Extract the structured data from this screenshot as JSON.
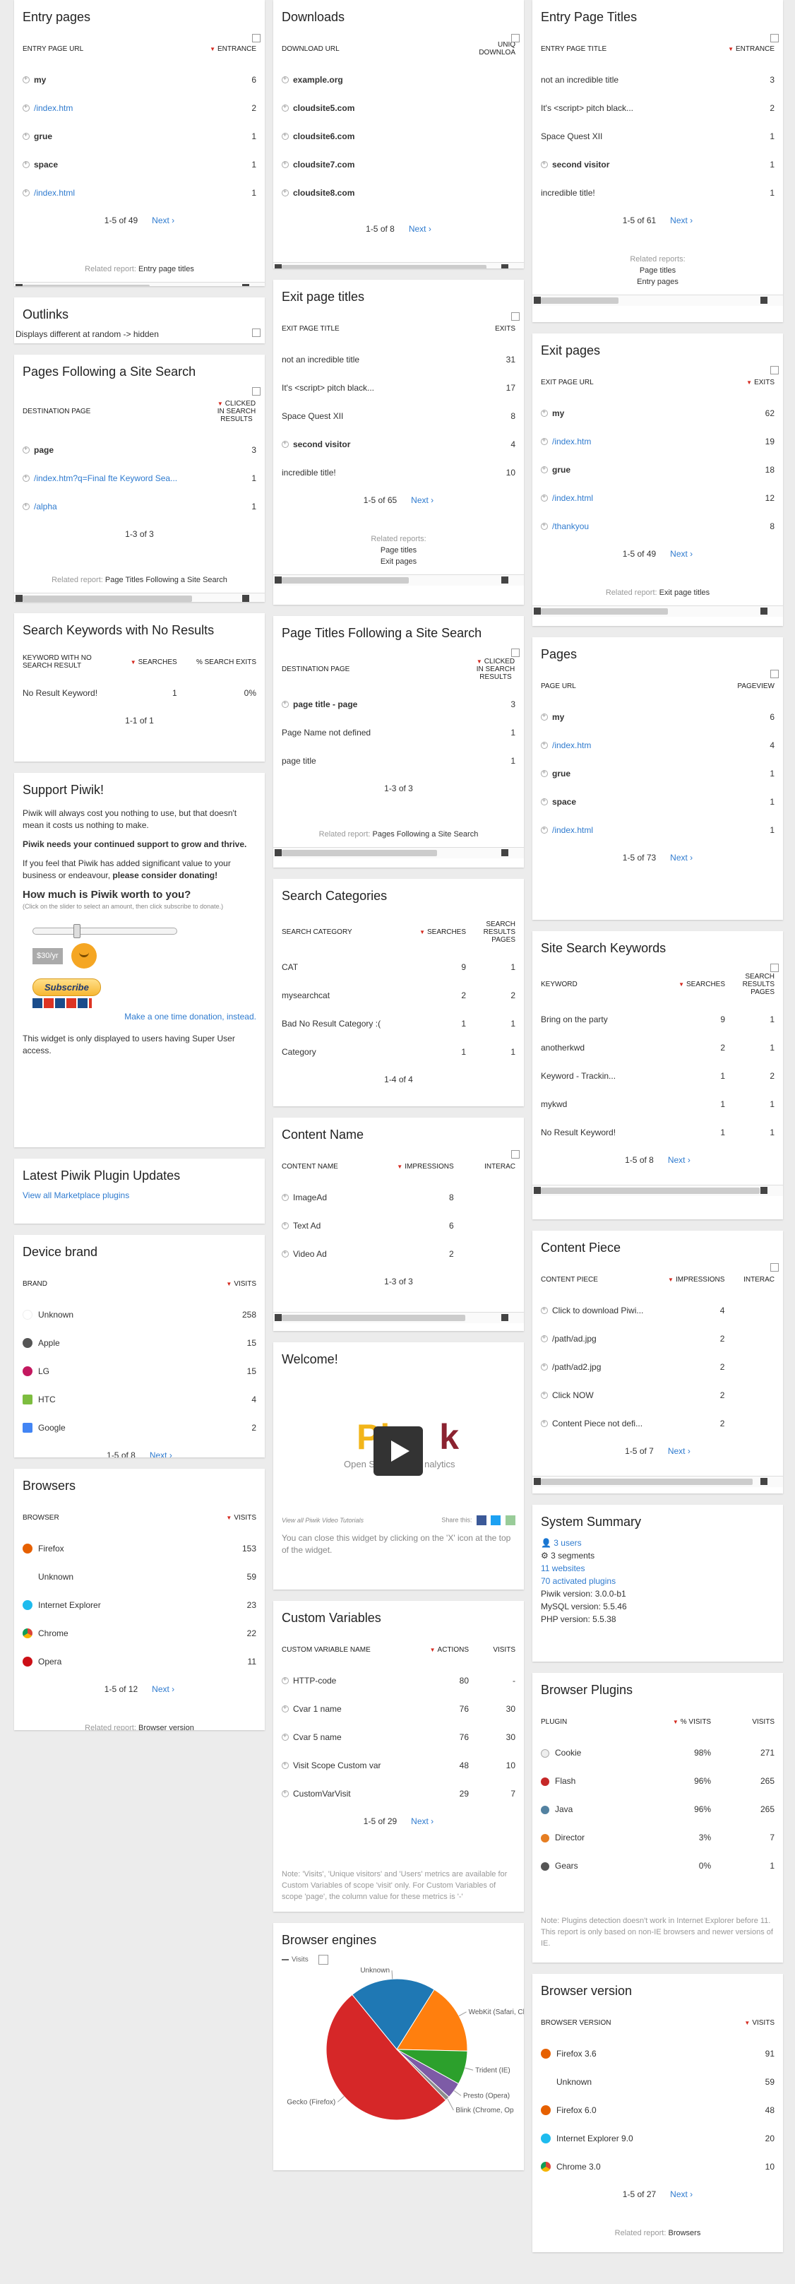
{
  "entry_pages": {
    "title": "Entry pages",
    "h1": "ENTRY PAGE URL",
    "h2": "ENTRANCE",
    "rows": [
      {
        "l": "my",
        "v": "6",
        "b": true
      },
      {
        "l": "/index.htm",
        "v": "2",
        "a": true
      },
      {
        "l": "grue",
        "v": "1",
        "b": true
      },
      {
        "l": "space",
        "v": "1",
        "b": true
      },
      {
        "l": "/index.html",
        "v": "1",
        "a": true
      }
    ],
    "pager": "1-5 of 49",
    "next": "Next ›",
    "rel_label": "Related report:",
    "rel": "Entry page titles"
  },
  "outlinks": {
    "title": "Outlinks",
    "text": "Displays different at random -> hidden"
  },
  "pages_following": {
    "title": "Pages Following a Site Search",
    "h1": "DESTINATION PAGE",
    "h2": "CLICKED IN SEARCH RESULTS",
    "rows": [
      {
        "l": "page",
        "v": "3",
        "b": true
      },
      {
        "l": "/index.htm?q=Final fte Keyword Sea...",
        "v": "1",
        "a": true
      },
      {
        "l": "/alpha",
        "v": "1",
        "a": true
      }
    ],
    "pager": "1-3 of 3",
    "rel_label": "Related report:",
    "rel": "Page Titles Following a Site Search"
  },
  "search_no_result": {
    "title": "Search Keywords with No Results",
    "h1": "KEYWORD WITH NO SEARCH RESULT",
    "h2": "SEARCHES",
    "h3": "% SEARCH EXITS",
    "row": {
      "l": "No Result Keyword!",
      "v": "1",
      "p": "0%"
    },
    "pager": "1-1 of 1"
  },
  "support": {
    "title": "Support Piwik!",
    "p1": "Piwik will always cost you nothing to use, but that doesn't mean it costs us nothing to make.",
    "p2": "Piwik needs your continued support to grow and thrive.",
    "p3a": "If you feel that Piwik has added significant value to your business or endeavour, ",
    "p3b": "please consider donating!",
    "h": "How much is Piwik worth to you?",
    "hint": "(Click on the slider to select an amount, then click subscribe to donate.)",
    "amount": "$30/yr",
    "subscribe": "Subscribe",
    "onetime": "Make a one time donation, instead.",
    "footer": "This widget is only displayed to users having Super User access."
  },
  "plugin_updates": {
    "title": "Latest Piwik Plugin Updates",
    "link": "View all Marketplace plugins"
  },
  "device_brand": {
    "title": "Device brand",
    "h1": "BRAND",
    "h2": "VISITS",
    "rows": [
      {
        "l": "Unknown",
        "v": "258",
        "c": "#ffffff"
      },
      {
        "l": "Apple",
        "v": "15",
        "c": "#555555"
      },
      {
        "l": "LG",
        "v": "15",
        "c": "#c3185f"
      },
      {
        "l": "HTC",
        "v": "4",
        "c": "#7dbd3f"
      },
      {
        "l": "Google",
        "v": "2",
        "c": "#4285f4"
      }
    ],
    "pager": "1-5 of 8"
  },
  "browsers": {
    "title": "Browsers",
    "h1": "BROWSER",
    "h2": "VISITS",
    "rows": [
      {
        "l": "Firefox",
        "v": "153",
        "c": "#e66000"
      },
      {
        "l": "Unknown",
        "v": "59",
        "c": "#ffffff"
      },
      {
        "l": "Internet Explorer",
        "v": "23",
        "c": "#1ebbee"
      },
      {
        "l": "Chrome",
        "v": "22",
        "c": "#db4437"
      },
      {
        "l": "Opera",
        "v": "11",
        "c": "#cc0f16"
      }
    ],
    "pager": "1-5 of 12",
    "rel_label": "Related report:",
    "rel": "Browser version"
  },
  "downloads": {
    "title": "Downloads",
    "h1": "DOWNLOAD URL",
    "h2": "UNIQ DOWNLOA",
    "rows": [
      {
        "l": "example.org"
      },
      {
        "l": "cloudsite5.com"
      },
      {
        "l": "cloudsite6.com"
      },
      {
        "l": "cloudsite7.com"
      },
      {
        "l": "cloudsite8.com"
      }
    ],
    "pager": "1-5 of 8"
  },
  "exit_titles": {
    "title": "Exit page titles",
    "h1": "EXIT PAGE TITLE",
    "h2": "EXITS",
    "rows": [
      {
        "l": "not an incredible title",
        "v": "31"
      },
      {
        "l": "It's <script> pitch black...",
        "v": "17"
      },
      {
        "l": "Space Quest XII",
        "v": "8"
      },
      {
        "l": "second visitor",
        "v": "4",
        "b": true
      },
      {
        "l": "incredible title!",
        "v": "10"
      }
    ],
    "pager": "1-5 of 65",
    "rel_label": "Related reports:",
    "rel1": "Page titles",
    "rel2": "Exit pages"
  },
  "titles_following": {
    "title": "Page Titles Following a Site Search",
    "h1": "DESTINATION PAGE",
    "h2": "CLICKED IN SEARCH RESULTS",
    "rows": [
      {
        "l": "page title - page",
        "v": "3",
        "b": true
      },
      {
        "l": "Page Name not defined",
        "v": "1"
      },
      {
        "l": "page title",
        "v": "1"
      }
    ],
    "pager": "1-3 of 3",
    "rel_label": "Related report:",
    "rel": "Pages Following a Site Search"
  },
  "search_categories": {
    "title": "Search Categories",
    "h1": "SEARCH CATEGORY",
    "h2": "SEARCHES",
    "h3": "SEARCH RESULTS PAGES",
    "rows": [
      {
        "l": "CAT",
        "v": "9",
        "p": "1"
      },
      {
        "l": "mysearchcat",
        "v": "2",
        "p": "2"
      },
      {
        "l": "Bad No Result Category :(",
        "v": "1",
        "p": "1"
      },
      {
        "l": "Category",
        "v": "1",
        "p": "1"
      }
    ],
    "pager": "1-4 of 4"
  },
  "content_name": {
    "title": "Content Name",
    "h1": "CONTENT NAME",
    "h2": "IMPRESSIONS",
    "h3": "INTERAC",
    "rows": [
      {
        "l": "ImageAd",
        "v": "8"
      },
      {
        "l": "Text Ad",
        "v": "6"
      },
      {
        "l": "Video Ad",
        "v": "2"
      }
    ],
    "pager": "1-3 of 3"
  },
  "welcome": {
    "title": "Welcome!",
    "logo_a": "Pi",
    "logo_b": "k",
    "sub": "Open S",
    "sub2": "nalytics",
    "tutorials": "View all Piwik Video Tutorials",
    "share": "Share this:",
    "text": "You can close this widget by clicking on the 'X' icon at the top of the widget."
  },
  "custom_vars": {
    "title": "Custom Variables",
    "h1": "CUSTOM VARIABLE NAME",
    "h2": "ACTIONS",
    "h3": "VISITS",
    "rows": [
      {
        "l": "HTTP-code",
        "v": "80",
        "p": "-"
      },
      {
        "l": "Cvar 1 name",
        "v": "76",
        "p": "30"
      },
      {
        "l": "Cvar 5 name",
        "v": "76",
        "p": "30"
      },
      {
        "l": "Visit Scope Custom var",
        "v": "48",
        "p": "10"
      },
      {
        "l": "CustomVarVisit",
        "v": "29",
        "p": "7"
      }
    ],
    "pager": "1-5 of 29",
    "note": "Note: 'Visits', 'Unique visitors' and 'Users' metrics are available for Custom Variables of scope 'visit' only. For Custom Variables of scope 'page', the column value for these metrics is '-'"
  },
  "engines": {
    "title": "Browser engines",
    "legend": "Visits",
    "chart_data": {
      "type": "pie",
      "labels": [
        "Unknown",
        "WebKit (Safari, Chr",
        "Trident (IE)",
        "Presto (Opera)",
        "Blink (Chrome, Op",
        "Gecko (Firefox)"
      ],
      "values": [
        59,
        49,
        23,
        11,
        3,
        153
      ],
      "colors": [
        "#1f78b4",
        "#ff7f0e",
        "#2ca02c",
        "#7d5ba6",
        "#8c8c8c",
        "#d62728"
      ]
    }
  },
  "entry_titles": {
    "title": "Entry Page Titles",
    "h1": "ENTRY PAGE TITLE",
    "h2": "ENTRANCE",
    "rows": [
      {
        "l": "not an incredible title",
        "v": "3"
      },
      {
        "l": "It's <script> pitch black...",
        "v": "2"
      },
      {
        "l": "Space Quest XII",
        "v": "1"
      },
      {
        "l": "second visitor",
        "v": "1",
        "b": true
      },
      {
        "l": "incredible title!",
        "v": "1"
      }
    ],
    "pager": "1-5 of 61",
    "rel_label": "Related reports:",
    "rel1": "Page titles",
    "rel2": "Entry pages"
  },
  "exit_pages": {
    "title": "Exit pages",
    "h1": "EXIT PAGE URL",
    "h2": "EXITS",
    "rows": [
      {
        "l": "my",
        "v": "62",
        "b": true
      },
      {
        "l": "/index.htm",
        "v": "19",
        "a": true
      },
      {
        "l": "grue",
        "v": "18",
        "b": true
      },
      {
        "l": "/index.html",
        "v": "12",
        "a": true
      },
      {
        "l": "/thankyou",
        "v": "8",
        "a": true
      }
    ],
    "pager": "1-5 of 49",
    "rel_label": "Related report:",
    "rel": "Exit page titles"
  },
  "pages": {
    "title": "Pages",
    "h1": "PAGE URL",
    "h2": "PAGEVIEW",
    "rows": [
      {
        "l": "my",
        "v": "6",
        "b": true
      },
      {
        "l": "/index.htm",
        "v": "4",
        "a": true
      },
      {
        "l": "grue",
        "v": "1",
        "b": true
      },
      {
        "l": "space",
        "v": "1",
        "b": true
      },
      {
        "l": "/index.html",
        "v": "1",
        "a": true
      }
    ],
    "pager": "1-5 of 73"
  },
  "site_search": {
    "title": "Site Search Keywords",
    "h1": "KEYWORD",
    "h2": "SEARCHES",
    "h3": "SEARCH RESULTS PAGES",
    "rows": [
      {
        "l": "Bring on the party",
        "v": "9",
        "p": "1"
      },
      {
        "l": "anotherkwd",
        "v": "2",
        "p": "1"
      },
      {
        "l": "Keyword - Trackin...",
        "v": "1",
        "p": "2"
      },
      {
        "l": "mykwd",
        "v": "1",
        "p": "1"
      },
      {
        "l": "No Result Keyword!",
        "v": "1",
        "p": "1"
      }
    ],
    "pager": "1-5 of 8"
  },
  "content_piece": {
    "title": "Content Piece",
    "h1": "CONTENT PIECE",
    "h2": "IMPRESSIONS",
    "h3": "INTERAC",
    "rows": [
      {
        "l": "Click to download Piwi...",
        "v": "4"
      },
      {
        "l": "/path/ad.jpg",
        "v": "2"
      },
      {
        "l": "/path/ad2.jpg",
        "v": "2"
      },
      {
        "l": "Click NOW",
        "v": "2"
      },
      {
        "l": "Content Piece not defi...",
        "v": "2"
      }
    ],
    "pager": "1-5 of 7"
  },
  "system": {
    "title": "System Summary",
    "users": "3 users",
    "segments": "3 segments",
    "websites": "11 websites",
    "plugins": "70 activated plugins",
    "piwik": "Piwik version: 3.0.0-b1",
    "mysql": "MySQL version: 5.5.46",
    "php": "PHP version: 5.5.38"
  },
  "browser_plugins": {
    "title": "Browser Plugins",
    "h1": "PLUGIN",
    "h2": "% VISITS",
    "h3": "VISITS",
    "rows": [
      {
        "l": "Cookie",
        "v": "98%",
        "p": "271"
      },
      {
        "l": "Flash",
        "v": "96%",
        "p": "265"
      },
      {
        "l": "Java",
        "v": "96%",
        "p": "265"
      },
      {
        "l": "Director",
        "v": "3%",
        "p": "7"
      },
      {
        "l": "Gears",
        "v": "0%",
        "p": "1"
      }
    ],
    "note": "Note: Plugins detection doesn't work in Internet Explorer before 11. This report is only based on non-IE browsers and newer versions of IE."
  },
  "browser_version": {
    "title": "Browser version",
    "h1": "BROWSER VERSION",
    "h2": "VISITS",
    "rows": [
      {
        "l": "Firefox 3.6",
        "v": "91",
        "c": "#e66000"
      },
      {
        "l": "Unknown",
        "v": "59",
        "c": "#ffffff"
      },
      {
        "l": "Firefox 6.0",
        "v": "48",
        "c": "#e66000"
      },
      {
        "l": "Internet Explorer 9.0",
        "v": "20",
        "c": "#1ebbee"
      },
      {
        "l": "Chrome 3.0",
        "v": "10",
        "c": "#db4437"
      }
    ],
    "pager": "1-5 of 27",
    "rel_label": "Related report:",
    "rel": "Browsers"
  },
  "next": "Next ›"
}
